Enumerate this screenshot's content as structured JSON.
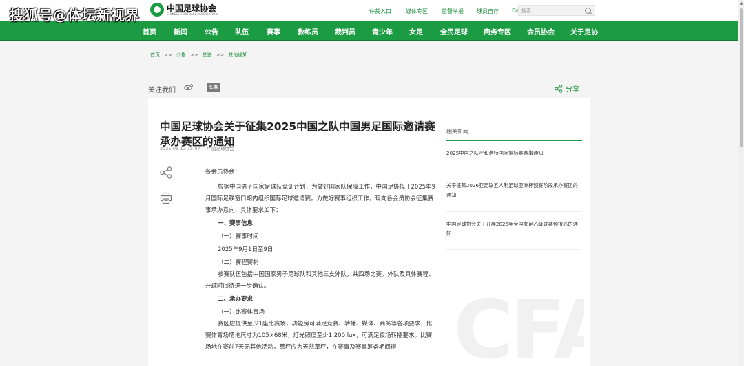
{
  "watermark": "搜狐号@体坛新视界",
  "logo": {
    "name": "中国足球协会",
    "subtitle": "CHINESE FOOTBALL ASSOCIATION"
  },
  "top_links": [
    "仲裁入口",
    "媒体专区",
    "监督举报",
    "球员自荐",
    "En"
  ],
  "search": {
    "placeholder": "搜索"
  },
  "nav": [
    "首页",
    "新闻",
    "公告",
    "队伍",
    "赛事",
    "教练员",
    "裁判员",
    "青少年",
    "女足",
    "全民足球",
    "商务专区",
    "会员协会",
    "关于足协"
  ],
  "breadcrumb": [
    "首页",
    "公告",
    "总览",
    "其他通知"
  ],
  "breadcrumb_sep": ">>",
  "social": {
    "follow_label": "关注我们",
    "toutiao": "头条",
    "share_label": "分享"
  },
  "article": {
    "title": "中国足球协会关于征集2025中国之队中国男足国际邀请赛承办赛区的通知",
    "date": "2025-05-13 15:07",
    "source": "中国足球协会",
    "greeting": "各会员协会：",
    "para1": "根据中国男子国家足球队竞训计划，为做好国家队保障工作，中国足协拟于2025年9月国际足联窗口期内组织国际足球邀请赛。为做好赛事组织工作，现向各会员协会征集赛事承办意向，具体要求如下：",
    "sec1": "一、赛事信息",
    "sub1": "（一）赛事时间",
    "date_text": "2025年9月1日至9日",
    "sub2": "（二）赛程赛制",
    "para2": "参赛队伍包括中国国家男子足球队和其他三支外队，共四场比赛。外队及具体赛程、开球时间待进一步确认。",
    "sec2": "二、承办要求",
    "sub3": "（一）比赛体育场",
    "para3": "赛区应提供至少1座比赛场，功能房可满足竞赛、转播、媒体、商务等各项要求，比赛体育场场地尺寸为105×68米，灯光照度至少1,200 lux，可满足夜场转播要求。比赛场地在赛前7天无其他活动，草坪应为天然草坪，在赛事及赛事筹备期间得"
  },
  "related": {
    "heading": "相关新闻",
    "items": [
      "2025中国之队呼和浩特国际锦标赛赛事通知",
      "关于征集2026亚足联五人制足球亚洲杯预赛阶段承办赛区的通知",
      "中国足球协会关于开展2025年全国女足乙级联赛预报名的通知"
    ]
  },
  "background_mark": "CFA",
  "colors": {
    "brand_green": "#1b9b42",
    "link_green": "#1b8e3d"
  }
}
